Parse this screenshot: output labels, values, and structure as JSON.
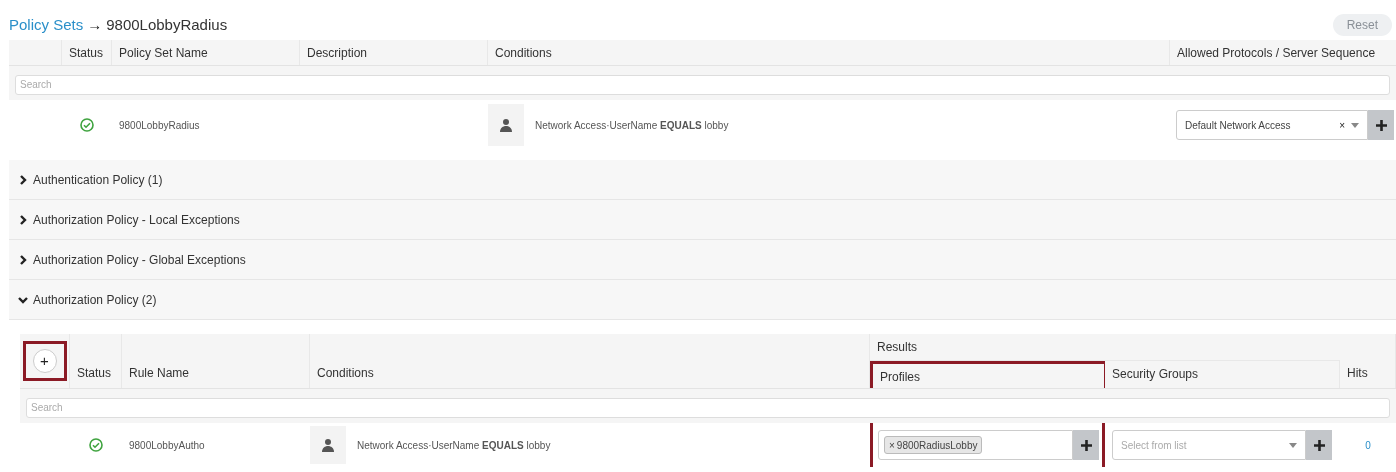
{
  "breadcrumb": {
    "link": "Policy Sets",
    "separator": "→",
    "current": "9800LobbyRadius"
  },
  "reset_button": {
    "label": "Reset",
    "disabled": true
  },
  "policy_set_table": {
    "columns": [
      "Status",
      "Policy Set Name",
      "Description",
      "Conditions",
      "Allowed Protocols / Server Sequence"
    ],
    "search": {
      "placeholder": "Search"
    },
    "rows": [
      {
        "enabled": true,
        "name": "9800LobbyRadius",
        "condition": "Network Access·UserName **EQUALS** lobby",
        "allowed": {
          "value": "Default Network Access",
          "clear": "×"
        }
      }
    ]
  },
  "sections": [
    {
      "title": "Authentication Policy (1)",
      "expanded": false
    },
    {
      "title": "Authorization Policy - Local Exceptions",
      "expanded": false
    },
    {
      "title": "Authorization Policy - Global Exceptions",
      "expanded": false
    },
    {
      "title": "Authorization Policy (2)",
      "expanded": true
    }
  ],
  "authorization_table": {
    "add_button": {
      "label": "+",
      "highlighted": true
    },
    "columns": [
      "Status",
      "Rule Name",
      "Conditions"
    ],
    "results_group": "Results",
    "result_columns": [
      {
        "label": "Profiles",
        "highlighted": true
      },
      {
        "label": "Security Groups",
        "highlighted": false
      }
    ],
    "hits_column": "Hits",
    "search": {
      "placeholder": "Search"
    },
    "rows": [
      {
        "enabled": true,
        "name": "9800LobbyAutho",
        "condition": "Network Access·UserName **EQUALS** lobby",
        "profile_tag": {
          "remove": "×",
          "label": "9800RadiusLobby"
        },
        "security_groups": {
          "placeholder": "Select from list"
        },
        "hits": "0"
      }
    ]
  }
}
